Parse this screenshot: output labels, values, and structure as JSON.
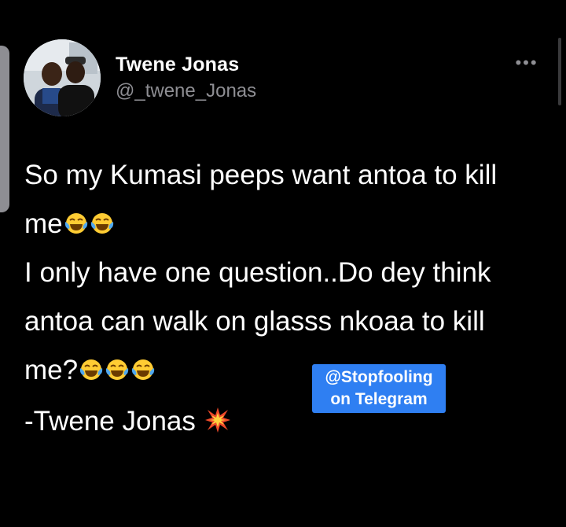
{
  "tweet": {
    "author": {
      "display_name": "Twene Jonas",
      "handle": "@_twene_Jonas"
    },
    "more_icon": "more-horizontal-icon",
    "lines": [
      {
        "text": "So my Kumasi peeps want antoa to kill",
        "emoji_count": 0
      },
      {
        "text": "me",
        "emoji_count": 2
      },
      {
        "text": "I only have one question..Do dey think",
        "emoji_count": 0
      },
      {
        "text": "antoa can walk on glasss nkoaa to kill",
        "emoji_count": 0
      },
      {
        "text": "me?",
        "emoji_count": 3
      }
    ],
    "emoji_name": "face-with-tears-of-joy-emoji",
    "signature": {
      "text": "-Twene Jonas",
      "emoji_name": "collision-emoji"
    }
  },
  "watermark": {
    "line1": "@Stopfooling",
    "line2": "on Telegram",
    "color": "#2f7ff2"
  },
  "colors": {
    "background": "#000000",
    "text": "#ffffff",
    "secondary_text": "#8e8e93"
  }
}
